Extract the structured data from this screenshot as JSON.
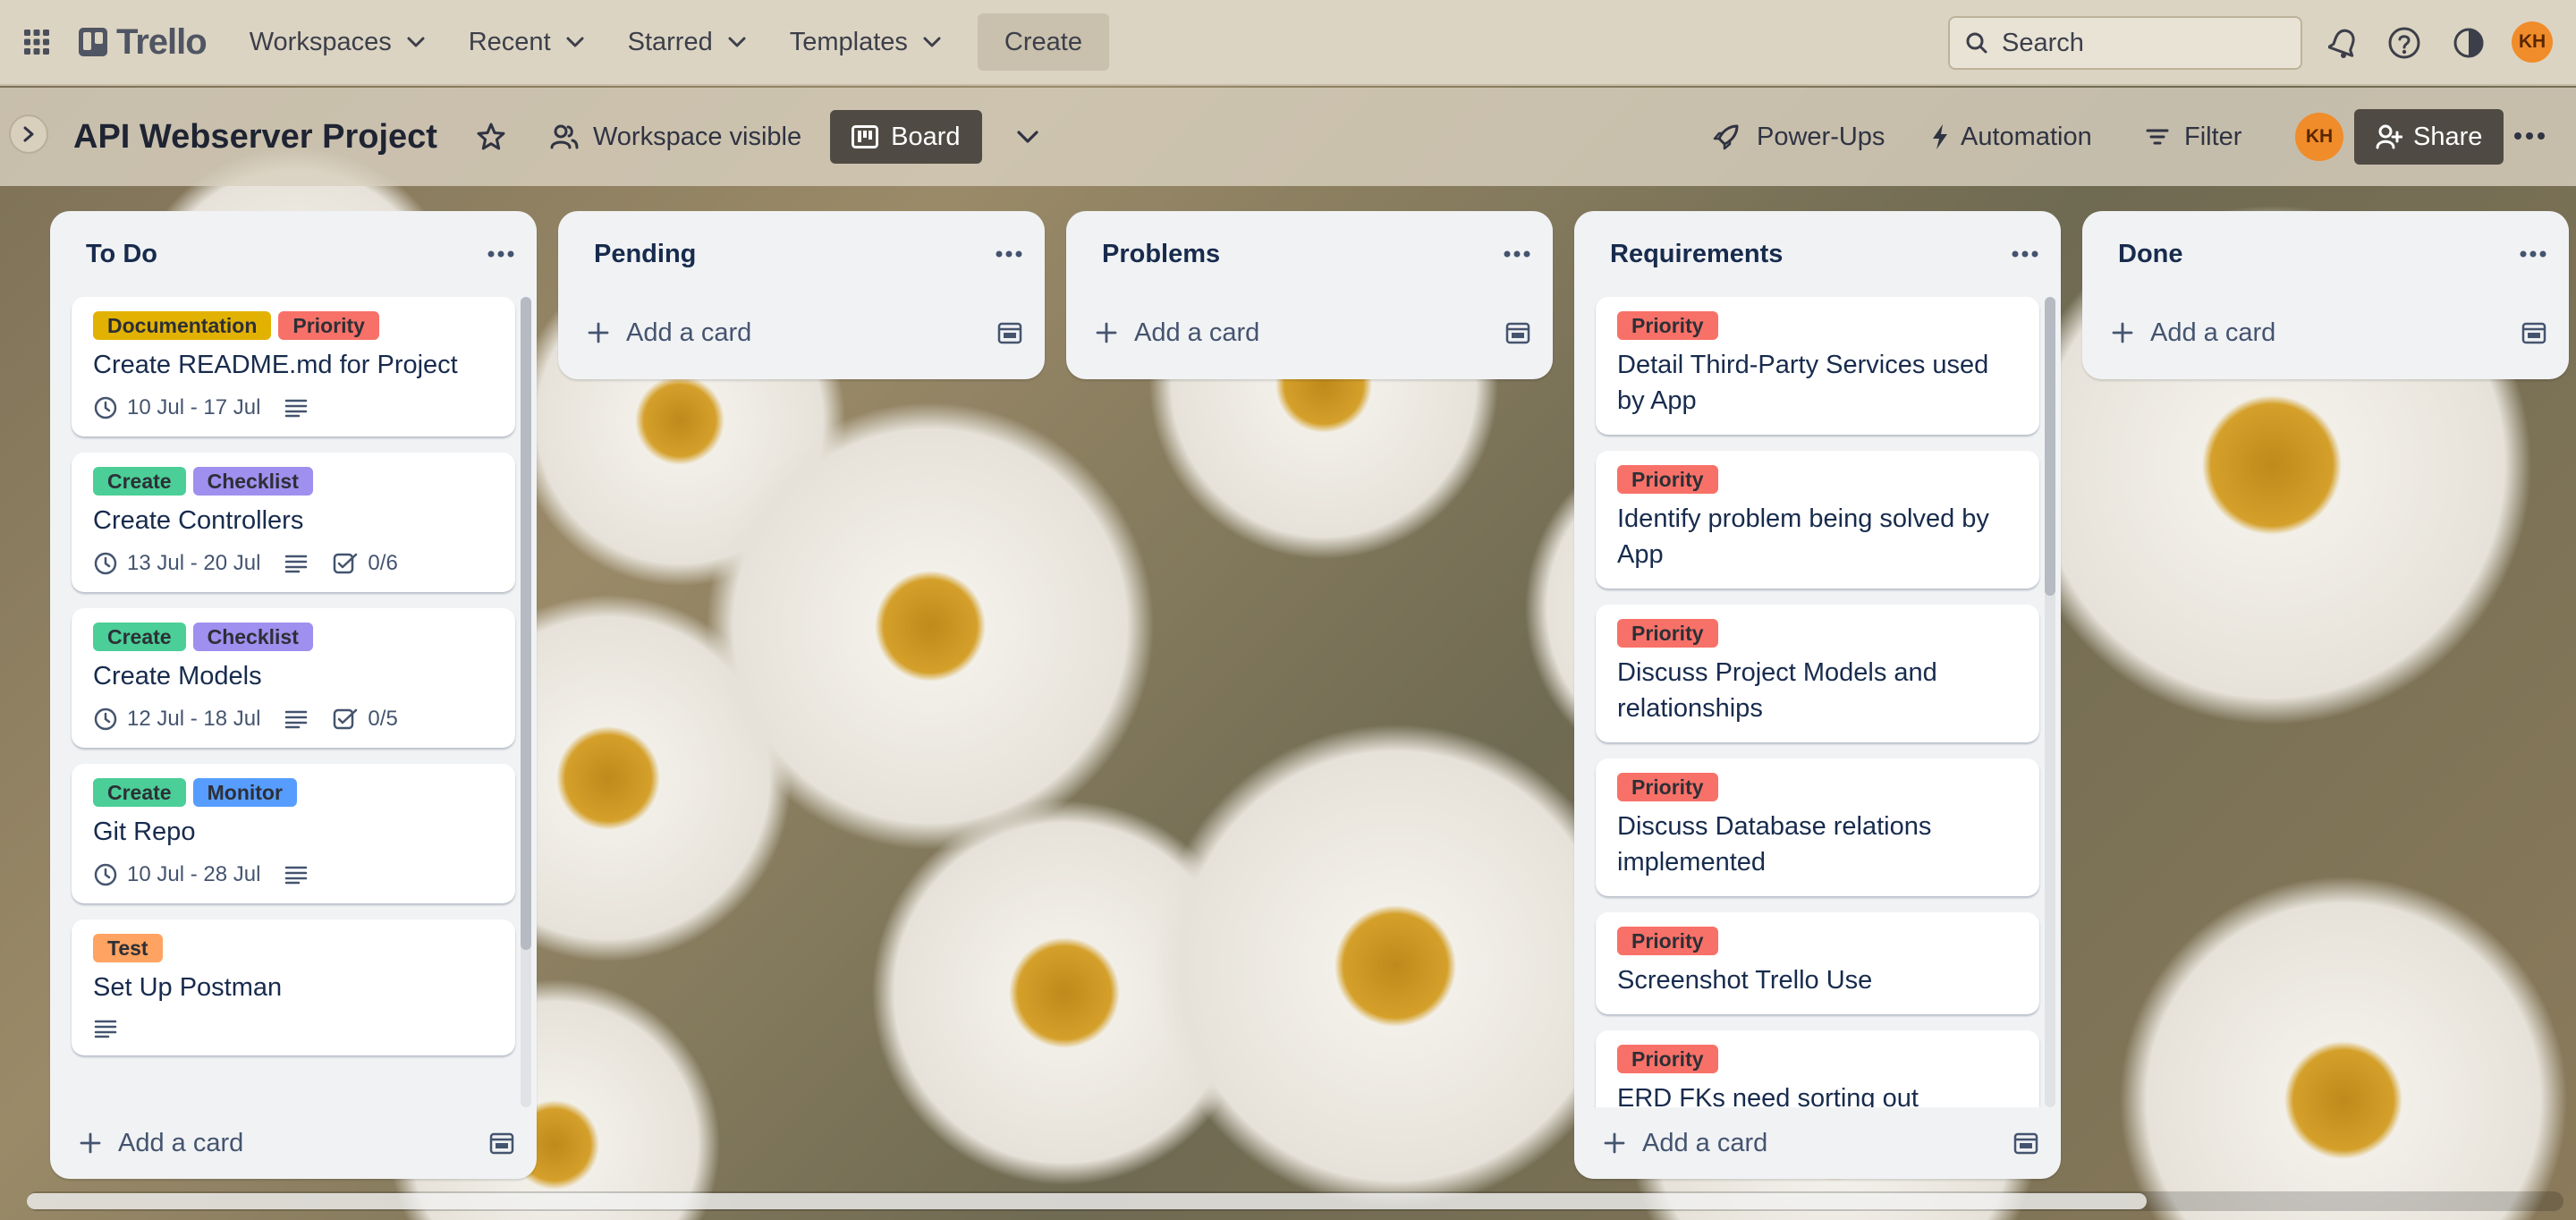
{
  "topbar": {
    "app_name": "Trello",
    "workspaces": "Workspaces",
    "recent": "Recent",
    "starred": "Starred",
    "templates": "Templates",
    "create": "Create",
    "search_placeholder": "Search",
    "avatar_initials": "KH"
  },
  "boardbar": {
    "title": "API Webserver Project",
    "visibility": "Workspace visible",
    "board_view": "Board",
    "power_ups": "Power-Ups",
    "automation": "Automation",
    "filter": "Filter",
    "member_initials": "KH",
    "share": "Share"
  },
  "colors": {
    "documentation": "#e2b203",
    "priority": "#f87168",
    "create": "#4bce97",
    "checklist": "#9f8fef",
    "monitor": "#579dff",
    "test": "#fea362",
    "avatar": "#f08c2a"
  },
  "add_card_label": "Add a card",
  "lists": [
    {
      "title": "To Do",
      "cards": [
        {
          "labels": [
            {
              "text": "Documentation",
              "color": "documentation"
            },
            {
              "text": "Priority",
              "color": "priority"
            }
          ],
          "title": "Create README.md for Project",
          "dates": "10 Jul - 17 Jul",
          "description": true,
          "checklist": ""
        },
        {
          "labels": [
            {
              "text": "Create",
              "color": "create"
            },
            {
              "text": "Checklist",
              "color": "checklist"
            }
          ],
          "title": "Create Controllers",
          "dates": "13 Jul - 20 Jul",
          "description": true,
          "checklist": "0/6"
        },
        {
          "labels": [
            {
              "text": "Create",
              "color": "create"
            },
            {
              "text": "Checklist",
              "color": "checklist"
            }
          ],
          "title": "Create Models",
          "dates": "12 Jul - 18 Jul",
          "description": true,
          "checklist": "0/5"
        },
        {
          "labels": [
            {
              "text": "Create",
              "color": "create"
            },
            {
              "text": "Monitor",
              "color": "monitor"
            }
          ],
          "title": "Git Repo",
          "dates": "10 Jul - 28 Jul",
          "description": true,
          "checklist": ""
        },
        {
          "labels": [
            {
              "text": "Test",
              "color": "test"
            }
          ],
          "title": "Set Up Postman",
          "dates": "",
          "description": true,
          "checklist": ""
        }
      ]
    },
    {
      "title": "Pending",
      "cards": []
    },
    {
      "title": "Problems",
      "cards": []
    },
    {
      "title": "Requirements",
      "cards": [
        {
          "labels": [
            {
              "text": "Priority",
              "color": "priority"
            }
          ],
          "title": "Detail Third-Party Services used by App",
          "dates": "",
          "description": false,
          "checklist": ""
        },
        {
          "labels": [
            {
              "text": "Priority",
              "color": "priority"
            }
          ],
          "title": "Identify problem being solved by App",
          "dates": "",
          "description": false,
          "checklist": ""
        },
        {
          "labels": [
            {
              "text": "Priority",
              "color": "priority"
            }
          ],
          "title": "Discuss Project Models and relationships",
          "dates": "",
          "description": false,
          "checklist": ""
        },
        {
          "labels": [
            {
              "text": "Priority",
              "color": "priority"
            }
          ],
          "title": "Discuss Database relations implemented",
          "dates": "",
          "description": false,
          "checklist": ""
        },
        {
          "labels": [
            {
              "text": "Priority",
              "color": "priority"
            }
          ],
          "title": "Screenshot Trello Use",
          "dates": "",
          "description": false,
          "checklist": ""
        },
        {
          "labels": [
            {
              "text": "Priority",
              "color": "priority"
            }
          ],
          "title": "ERD FKs need sorting out",
          "dates": "",
          "description": false,
          "checklist": ""
        }
      ]
    },
    {
      "title": "Done",
      "cards": []
    }
  ]
}
